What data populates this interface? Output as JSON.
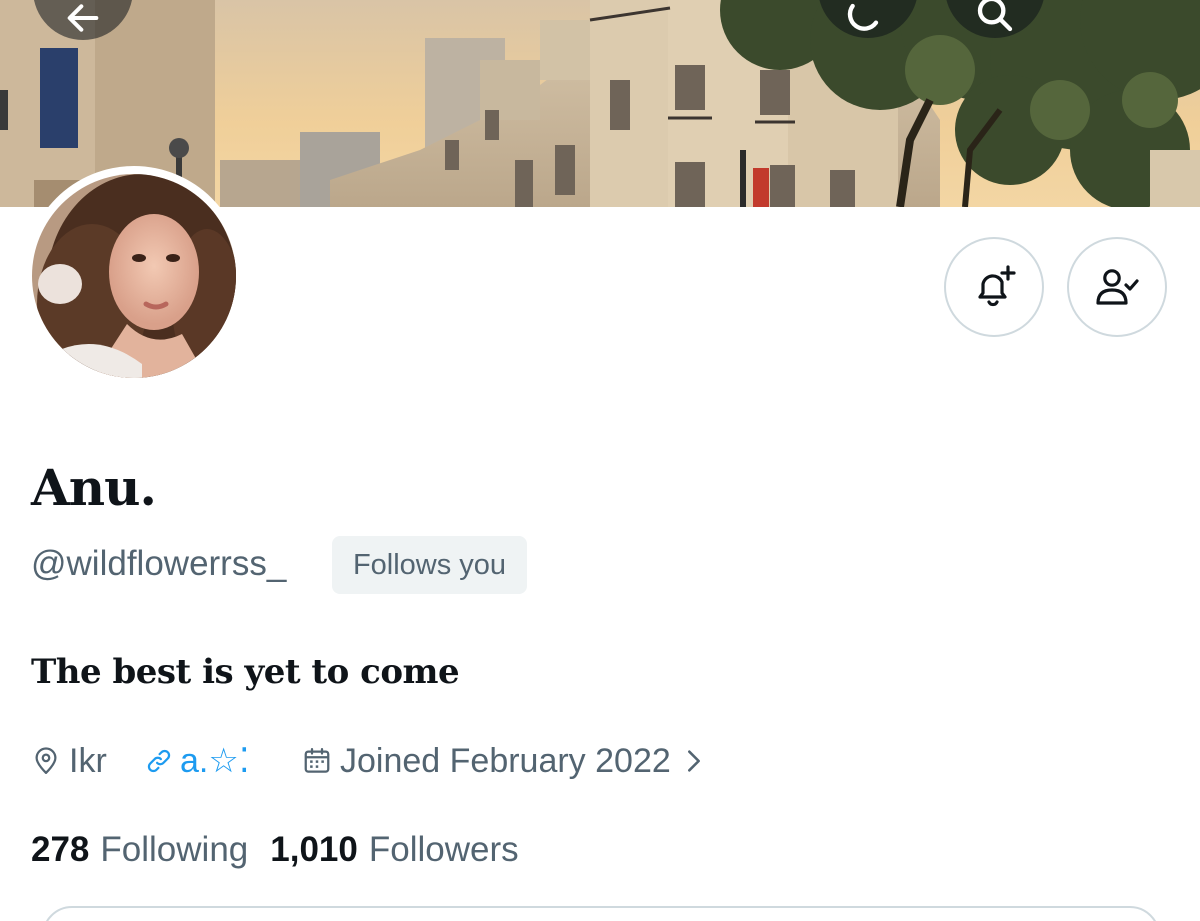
{
  "profile": {
    "display_name": "Anu.",
    "handle": "@wildflowerrss_",
    "follows_you_badge": "Follows you",
    "bio": "The best is yet to come",
    "location": "Ikr",
    "link_text": "a.☆⁚",
    "joined": "Joined February 2022",
    "following_count": "278",
    "following_label": "Following",
    "followers_count": "1,010",
    "followers_label": "Followers"
  },
  "icons": {
    "back": "arrow-left-icon",
    "more": "more-icon",
    "search": "search-icon",
    "notify": "bell-plus-icon",
    "following": "person-check-icon",
    "location": "location-pin-icon",
    "link": "link-icon",
    "calendar": "calendar-icon",
    "chevron": "chevron-right-icon"
  },
  "colors": {
    "text_primary": "#0f1419",
    "text_secondary": "#536471",
    "link": "#1d9bf0",
    "button_border": "#cfd9de",
    "badge_background": "#eff3f4"
  }
}
